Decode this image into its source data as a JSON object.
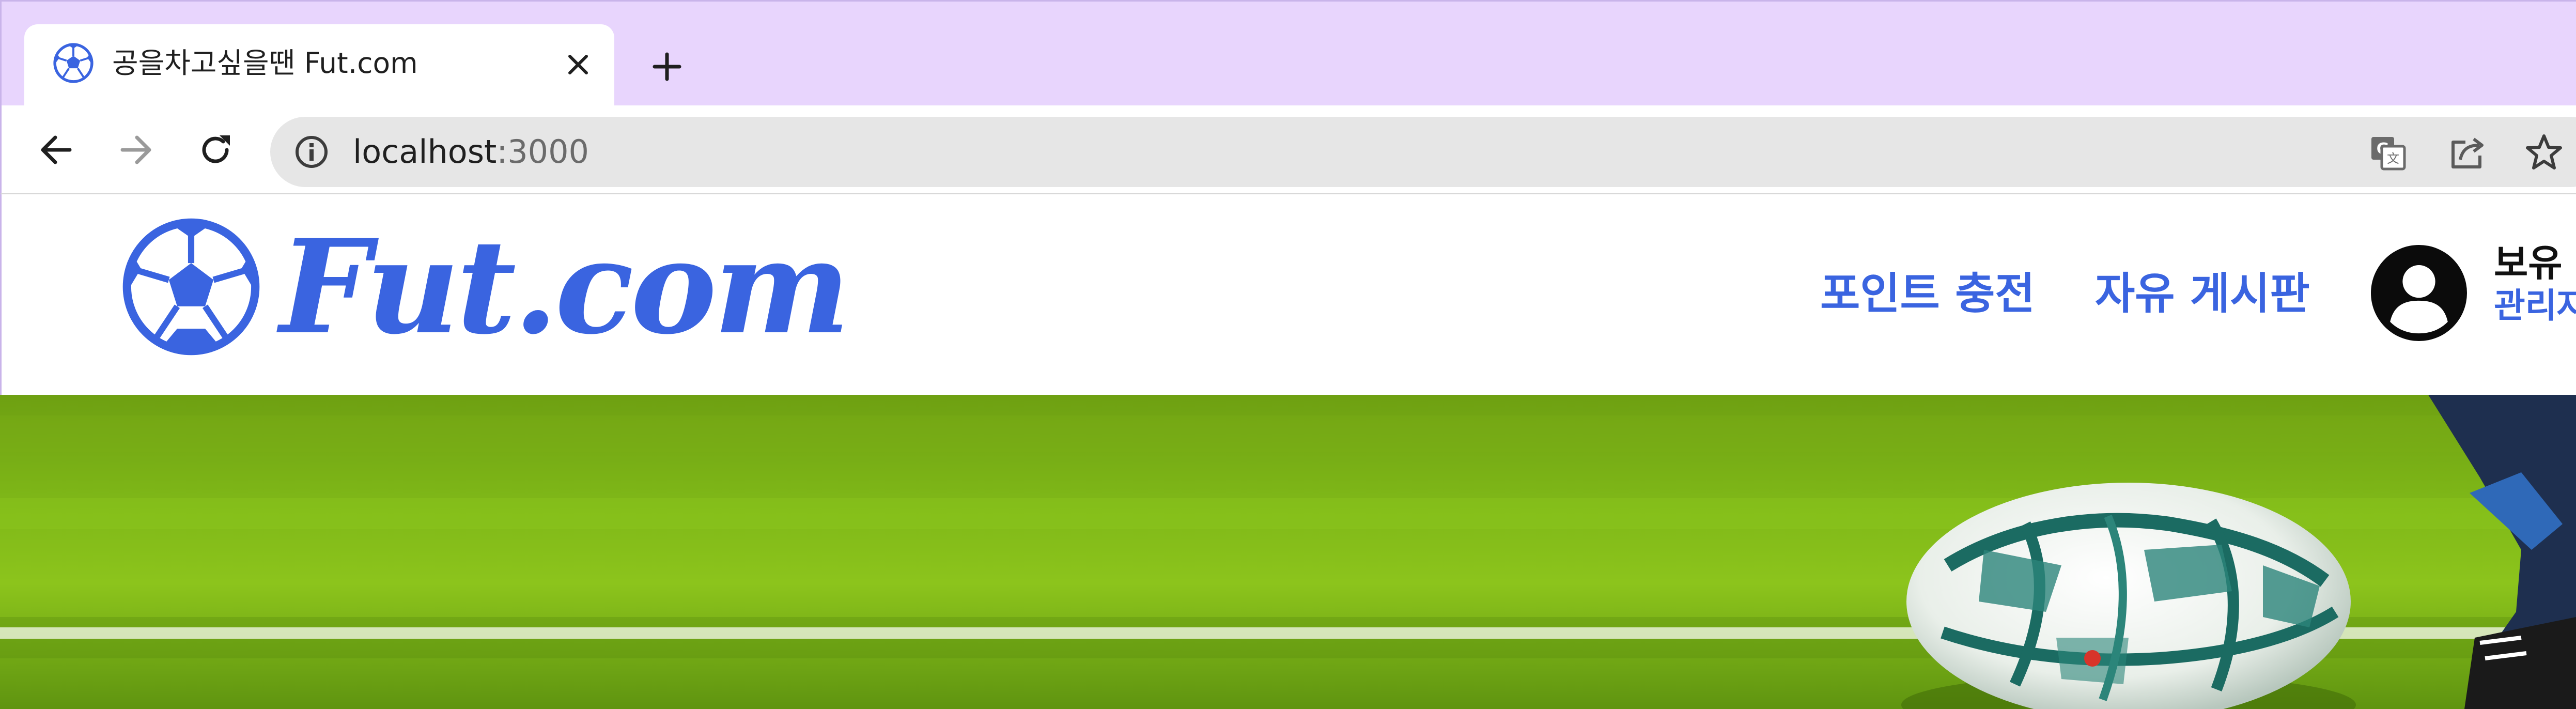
{
  "browser": {
    "tab": {
      "title": "공을차고싶을땐 Fut.com",
      "favicon": "soccer-ball-icon",
      "close_icon": "close-icon"
    },
    "new_tab_icon": "plus-icon",
    "nav": {
      "back_icon": "arrow-left-icon",
      "forward_icon": "arrow-right-icon",
      "reload_icon": "reload-icon"
    },
    "address_bar": {
      "host": "localhost",
      "port": ":3000",
      "info_icon": "info-icon",
      "translate_icon": "translate-icon",
      "share_icon": "share-icon",
      "bookmark_icon": "star-icon"
    },
    "colors": {
      "tabstrip_bg": "#e8d5fd",
      "omnibox_bg": "#e6e6e6"
    }
  },
  "site": {
    "logo": {
      "text": "Fut.com",
      "icon": "soccer-ball-icon"
    },
    "nav": {
      "point_charge": "포인트 충전",
      "free_board": "자유 게시판"
    },
    "user": {
      "avatar_icon": "user-avatar-icon",
      "line1": "보유 .",
      "line2": "관리자"
    },
    "colors": {
      "brand_blue": "#3a64e0",
      "text_dark": "#111111"
    },
    "hero": {
      "image": "soccer-ball-on-grass-field"
    }
  }
}
